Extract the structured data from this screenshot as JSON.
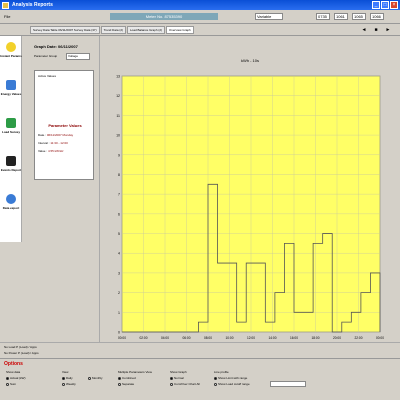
{
  "window": {
    "title": "Analysis Reports"
  },
  "toprow": {
    "menu": "File",
    "center_title": "Meter No. 87535390",
    "field1": "Variable",
    "field2": "0735",
    "field3": "1061",
    "field4": "1065",
    "field5": "1066"
  },
  "tabs": [
    "Survey Data Table 06/11/2007 Survey Data (37)",
    "Trend Data (2)",
    "Load Balance Graph (2)",
    "Overview Graph"
  ],
  "nav": {
    "prev": "◄",
    "stop": "■",
    "next": "►"
  },
  "leftbar": [
    {
      "label": "Instant Params",
      "color": "#f2d12a"
    },
    {
      "label": "Energy Values",
      "color": "#3a7bd5"
    },
    {
      "label": "Load Survey",
      "color": "#2d9c46"
    },
    {
      "label": "Events Report",
      "color": "#222222"
    },
    {
      "label": "Data export",
      "color": "#3a7bd5"
    }
  ],
  "info": {
    "graph_date": "Graph Date: 06/11/2007",
    "parameter_group": "Parameter Group",
    "parameter_selected": "Voltage",
    "active_title": "Active Values",
    "pv_title": "Parameter Values",
    "pv_rows": [
      {
        "k": "Date",
        "v": "06/11/2007 Monday"
      },
      {
        "k": "Interval",
        "v": "11:30 - 12:00"
      },
      {
        "k": "Value",
        "v": "4.55 kW/Hz"
      }
    ]
  },
  "chart_data": {
    "type": "line",
    "title": "kWh - 10s",
    "x": [
      "00:00",
      "01:00",
      "02:00",
      "03:00",
      "04:00",
      "05:00",
      "06:00",
      "07:00",
      "08:00",
      "09:00",
      "10:00",
      "11:00",
      "12:00",
      "13:00",
      "14:00",
      "15:00",
      "16:00",
      "17:00",
      "18:00",
      "19:00",
      "20:00",
      "21:00",
      "22:00",
      "23:00"
    ],
    "x_ticks": [
      "00:00",
      "02:00",
      "04:00",
      "06:00",
      "08:00",
      "10:00",
      "12:00",
      "14:00",
      "16:00",
      "18:00",
      "20:00",
      "22:00",
      "00:00"
    ],
    "series": [
      {
        "values": [
          0,
          0,
          0,
          0,
          0,
          0,
          0,
          0,
          0.5,
          7.5,
          3.5,
          3.5,
          0.5,
          3.5,
          3.5,
          0.5,
          2,
          4.5,
          1,
          1,
          4.5,
          5,
          0,
          0.5,
          1,
          2,
          3
        ]
      }
    ],
    "xlim": [
      0,
      24
    ],
    "ylim": [
      0,
      13
    ],
    "y_ticks": [
      0,
      1,
      2,
      3,
      4,
      5,
      6,
      7,
      8,
      9,
      10,
      11,
      12,
      13
    ],
    "grid": true,
    "bg_color": "#ffff66",
    "line_color": "#555555"
  },
  "bottom": {
    "line1": "No Load P (Load) / Apps",
    "line2": "No Power P (Load) / Apps"
  },
  "options": {
    "title": "Options",
    "show_rms": "Show data",
    "actual_values": "Actual (kW)",
    "sum": "Sum",
    "normalised": "Normalised",
    "view_label": "View",
    "daily": "Daily",
    "weekly": "Weekly",
    "monthly": "Monthly",
    "multiple": "Multiple Parameters View",
    "combined": "Combined",
    "separate": "Separate",
    "show_graph": "Show Graph",
    "normal": "Normal",
    "cumulative": "Cum/Over Chart All",
    "line_profile": "Line profile",
    "show_limit": "Show Limit with range",
    "show_limit2": "Show Load cutoff range"
  }
}
